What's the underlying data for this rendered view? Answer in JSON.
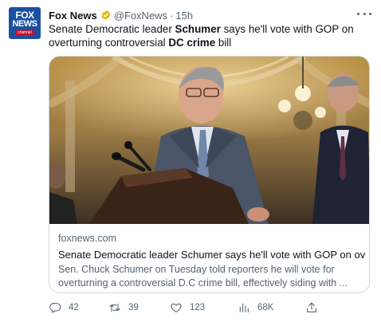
{
  "account": {
    "name": "Fox News",
    "handle": "@FoxNews",
    "time": "15h",
    "avatar_logo": {
      "line1": "FOX",
      "line2": "NEWS",
      "line3": "channel"
    },
    "verified_color": "#e2b719"
  },
  "tweet": {
    "text_1": "Senate Democratic leader ",
    "bold_1": "Schumer",
    "text_2": " says he'll vote with GOP on overturning controversial ",
    "bold_2": "DC crime",
    "text_3": " bill"
  },
  "card": {
    "image_icon": "news-photo-schumer-capitol",
    "domain": "foxnews.com",
    "title": "Senate Democratic leader Schumer says he'll vote with GOP on overt...",
    "description": "Sen. Chuck Schumer on Tuesday told reporters he will vote for overturning a controversial D.C crime bill, effectively siding with ..."
  },
  "actions": {
    "replies": "42",
    "retweets": "39",
    "likes": "123",
    "views": "68K"
  },
  "colors": {
    "text_primary": "#0f1419",
    "text_secondary": "#536471",
    "border": "#cfd9de",
    "fox_blue": "#1d4fa0",
    "fox_red": "#c8102e"
  }
}
